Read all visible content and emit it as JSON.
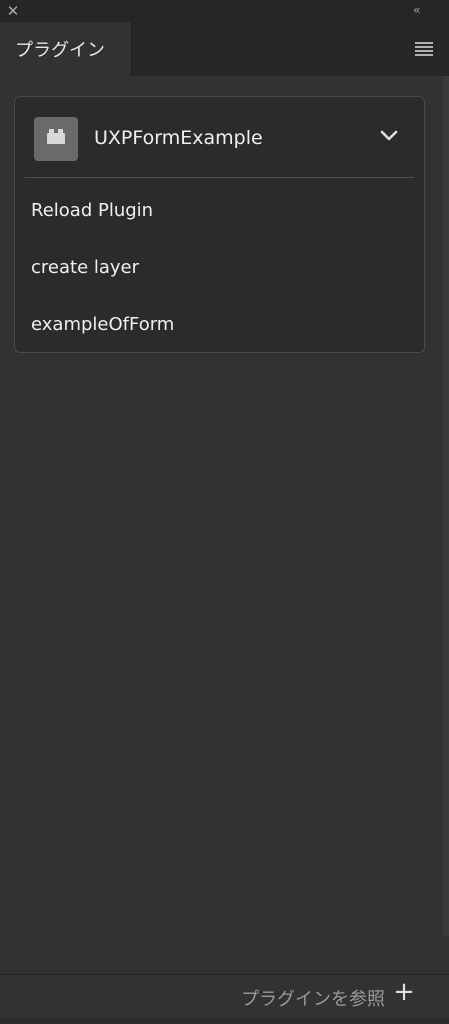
{
  "panel": {
    "close_glyph": "✕",
    "collapse_glyph": "‹‹",
    "tab_label": "プラグイン",
    "menu_icon": "hamburger-icon"
  },
  "plugin": {
    "name": "UXPFormExample",
    "icon": "plugin-brick-icon",
    "expanded": true,
    "commands": [
      {
        "label": "Reload Plugin"
      },
      {
        "label": "create layer"
      },
      {
        "label": "exampleOfForm"
      }
    ]
  },
  "footer": {
    "browse_label": "プラグインを参照",
    "add_glyph": "+"
  },
  "colors": {
    "panel_bg": "#323232",
    "card_bg": "#2b2b2b",
    "card_border": "#4a4a4a",
    "text": "#f0f0f0",
    "muted_text": "#9a9a9a"
  }
}
